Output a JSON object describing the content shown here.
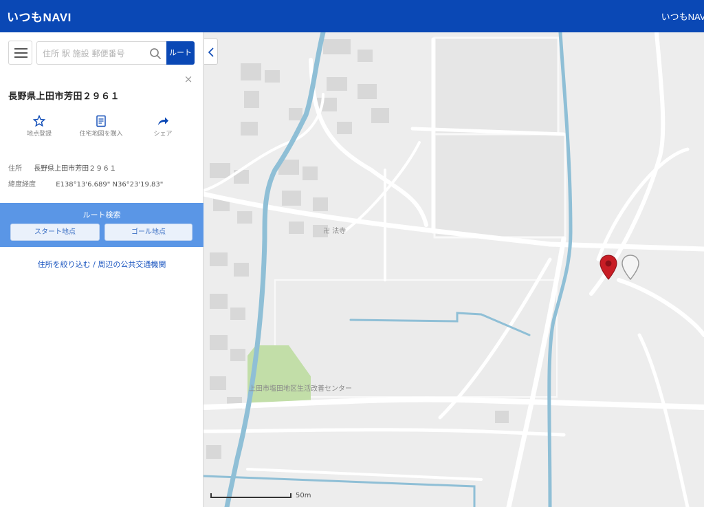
{
  "header": {
    "logo": "いつもNAVI",
    "right_link": "いつもNAVI"
  },
  "search": {
    "placeholder": "住所 駅 施設 郵便番号",
    "route_label": "ルート"
  },
  "place": {
    "title": "長野県上田市芳田２９６１",
    "close_label": "×",
    "actions": [
      {
        "icon": "star-icon",
        "label": "地点登録"
      },
      {
        "icon": "memo-icon",
        "label": "住宅地図を購入"
      },
      {
        "icon": "share-icon",
        "label": "シェア"
      }
    ],
    "info": {
      "address_key": "住所",
      "address_value": "長野県上田市芳田２９６１",
      "coords_key": "緯度経度",
      "coords_value": "E138°13'6.689\" N36°23'19.83\""
    }
  },
  "route": {
    "title": "ルート検索",
    "start_label": "スタート地点",
    "goal_label": "ゴール地点"
  },
  "nearby_link": "住所を絞り込む / 周辺の公共交通機関",
  "map": {
    "labels": {
      "temple": "法寺",
      "center": "上田市塩田地区生活改善センター",
      "temple_small": "卍"
    },
    "scale_label": "50m",
    "colors": {
      "water": "#8fbfd6",
      "park": "#c2dea8",
      "marker_active": "#c81d25"
    }
  }
}
